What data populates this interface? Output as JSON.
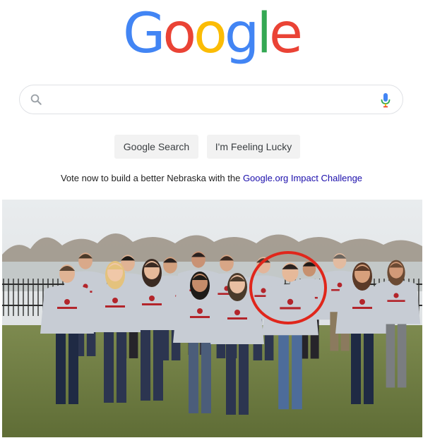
{
  "logo": {
    "letters": [
      "G",
      "o",
      "o",
      "g",
      "l",
      "e"
    ],
    "colors": [
      "#4285F4",
      "#EA4335",
      "#FBBC05",
      "#4285F4",
      "#34A853",
      "#EA4335"
    ]
  },
  "search": {
    "placeholder": "",
    "value": "",
    "icon_left": "search-icon",
    "icon_right": "mic-icon"
  },
  "buttons": {
    "search_label": "Google Search",
    "lucky_label": "I'm Feeling Lucky"
  },
  "promo": {
    "text": "Vote now to build a better Nebraska with the ",
    "link": "Google.org Impact Challenge"
  },
  "photo": {
    "hoodie_text": "NATIVE 360",
    "highlight_color": "#e0261b"
  }
}
